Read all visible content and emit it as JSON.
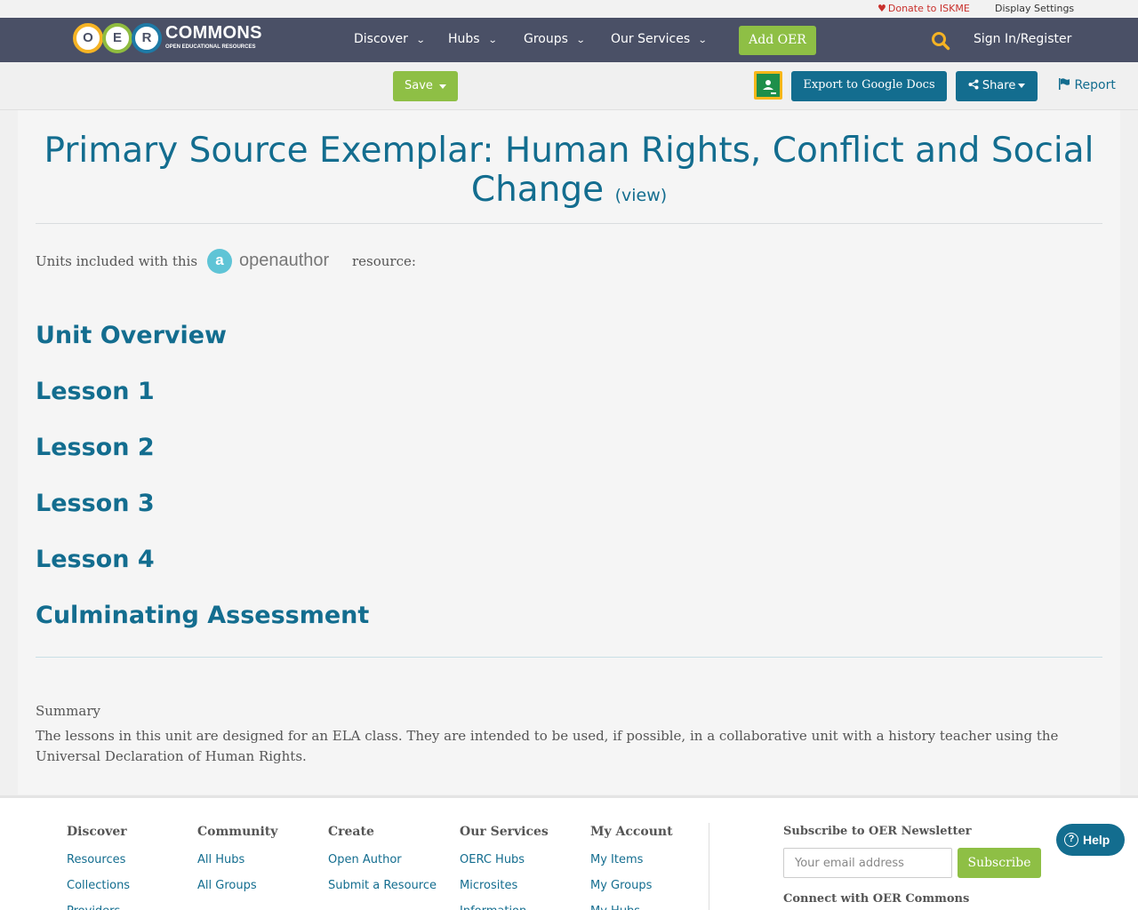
{
  "utility": {
    "donate": "Donate to ISKME",
    "display_settings": "Display Settings"
  },
  "logo": {
    "letters": [
      "O",
      "E",
      "R"
    ],
    "word": "COMMONS",
    "tagline": "OPEN EDUCATIONAL RESOURCES"
  },
  "nav": {
    "items": [
      "Discover",
      "Hubs",
      "Groups",
      "Our Services"
    ],
    "add_oer": "Add OER",
    "sign_in": "Sign In/Register"
  },
  "toolbar": {
    "save": "Save",
    "export": "Export to Google Docs",
    "share": "Share",
    "report": "Report"
  },
  "resource": {
    "title": "Primary Source Exemplar: Human Rights, Conflict and Social Change",
    "view_link": "(view)",
    "units_label": "Units included with this",
    "open_author_logo": "openauthor",
    "resource_label": "resource:",
    "units": [
      "Unit Overview",
      "Lesson 1",
      "Lesson 2",
      "Lesson 3",
      "Lesson 4",
      "Culminating Assessment"
    ],
    "summary_heading": "Summary",
    "summary_text": "The lessons in this unit are designed for an ELA class. They are intended to be used, if possible, in a collaborative unit with a history teacher using the Universal Declaration of Human Rights."
  },
  "footer": {
    "columns": [
      {
        "heading": "Discover",
        "links": [
          "Resources",
          "Collections",
          "Providers"
        ]
      },
      {
        "heading": "Community",
        "links": [
          "All Hubs",
          "All Groups"
        ]
      },
      {
        "heading": "Create",
        "links": [
          "Open Author",
          "Submit a Resource"
        ]
      },
      {
        "heading": "Our Services",
        "links": [
          "OERC Hubs",
          "Microsites",
          "Information"
        ]
      },
      {
        "heading": "My Account",
        "links": [
          "My Items",
          "My Groups",
          "My Hubs"
        ]
      }
    ],
    "newsletter_heading": "Subscribe to OER Newsletter",
    "email_placeholder": "Your email address",
    "subscribe": "Subscribe",
    "connect_heading": "Connect with OER Commons"
  },
  "help": "Help",
  "colors": {
    "nav_bg": "#4a5066",
    "accent_green": "#8ebf45",
    "brand_blue": "#136d8f",
    "donate_red": "#c9302c"
  }
}
